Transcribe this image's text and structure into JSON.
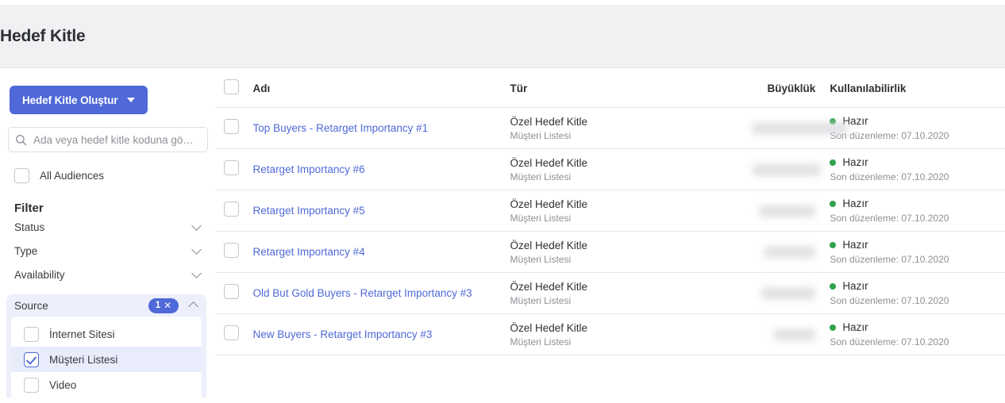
{
  "header": {
    "title": "Hedef Kitle"
  },
  "sidebar": {
    "create_button": "Hedef Kitle Oluştur",
    "search": {
      "placeholder": "Ada veya hedef kitle koduna gö…",
      "value": ""
    },
    "all_audiences_label": "All Audiences",
    "filter_title": "Filter",
    "filters": [
      {
        "label": "Status",
        "expanded": false
      },
      {
        "label": "Type",
        "expanded": false
      },
      {
        "label": "Availability",
        "expanded": false
      }
    ],
    "source": {
      "label": "Source",
      "badge_count": "1",
      "badge_clear": "✕",
      "expanded": true,
      "options": [
        {
          "label": "İnternet Sitesi",
          "checked": false
        },
        {
          "label": "Müşteri Listesi",
          "checked": true
        },
        {
          "label": "Video",
          "checked": false
        }
      ]
    }
  },
  "table": {
    "columns": {
      "name": "Adı",
      "type": "Tür",
      "size": "Büyüklük",
      "availability": "Kullanılabilirlik"
    },
    "rows": [
      {
        "name": "Top Buyers - Retarget Importancy #1",
        "type": "Özel Hedef Kitle",
        "type_sub": "Müşteri Listesi",
        "size": "",
        "size_redacted": true,
        "status": "Hazır",
        "last_edited": "Son düzenleme: 07.10.2020"
      },
      {
        "name": "Retarget Importancy #6",
        "type": "Özel Hedef Kitle",
        "type_sub": "Müşteri Listesi",
        "size": "",
        "size_redacted": true,
        "status": "Hazır",
        "last_edited": "Son düzenleme: 07.10.2020"
      },
      {
        "name": "Retarget Importancy #5",
        "type": "Özel Hedef Kitle",
        "type_sub": "Müşteri Listesi",
        "size": "",
        "size_redacted": true,
        "status": "Hazır",
        "last_edited": "Son düzenleme: 07.10.2020"
      },
      {
        "name": "Retarget Importancy #4",
        "type": "Özel Hedef Kitle",
        "type_sub": "Müşteri Listesi",
        "size": "",
        "size_redacted": true,
        "status": "Hazır",
        "last_edited": "Son düzenleme: 07.10.2020"
      },
      {
        "name": "Old But Gold Buyers - Retarget Importancy #3",
        "type": "Özel Hedef Kitle",
        "type_sub": "Müşteri Listesi",
        "size": "",
        "size_redacted": true,
        "status": "Hazır",
        "last_edited": "Son düzenleme: 07.10.2020"
      },
      {
        "name": "New Buyers - Retarget Importancy #3",
        "type": "Özel Hedef Kitle",
        "type_sub": "Müşteri Listesi",
        "size": "",
        "size_redacted": true,
        "status": "Hazır",
        "last_edited": "Son düzenleme: 07.10.2020"
      }
    ]
  },
  "colors": {
    "accent": "#4f69d8",
    "status_ready": "#31a24c",
    "header_bg": "#f0f1f2",
    "source_bg": "#edeffb",
    "source_selected": "#e9ecfb"
  }
}
